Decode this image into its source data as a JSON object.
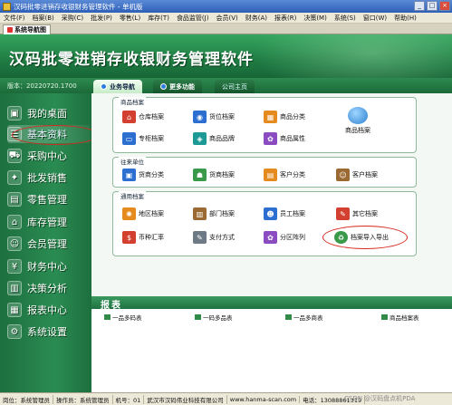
{
  "window": {
    "title": "汉码批零进销存收银财务管理软件 - 单机版",
    "buttons": [
      "_",
      "□",
      "×"
    ]
  },
  "menubar": [
    "文件(F)",
    "档案(B)",
    "采购(C)",
    "批发(P)",
    "零售(L)",
    "库存(T)",
    "食品监管(J)",
    "会员(V)",
    "财务(A)",
    "报表(R)",
    "决策(M)",
    "系统(S)",
    "窗口(W)",
    "帮助(H)"
  ],
  "doc_tab": "系统导航图",
  "banner_title": "汉码批零进销存收银财务管理软件",
  "version": "版本：20220720.1700",
  "top_tabs": [
    "业务导航",
    "更多功能",
    "公司主页"
  ],
  "sidebar": [
    {
      "label": "我的桌面",
      "icon": "monitor-icon",
      "glyph": "▣"
    },
    {
      "label": "基本资料",
      "icon": "data-icon",
      "glyph": "☰"
    },
    {
      "label": "采购中心",
      "icon": "truck-icon",
      "glyph": "⛟"
    },
    {
      "label": "批发销售",
      "icon": "sales-icon",
      "glyph": "✦"
    },
    {
      "label": "零售管理",
      "icon": "retail-icon",
      "glyph": "▤"
    },
    {
      "label": "库存管理",
      "icon": "warehouse-icon",
      "glyph": "⌂"
    },
    {
      "label": "会员管理",
      "icon": "member-icon",
      "glyph": "☺"
    },
    {
      "label": "财务中心",
      "icon": "finance-icon",
      "glyph": "¥"
    },
    {
      "label": "决策分析",
      "icon": "chart-icon",
      "glyph": "▥"
    },
    {
      "label": "报表中心",
      "icon": "report-icon",
      "glyph": "▦"
    },
    {
      "label": "系统设置",
      "icon": "settings-icon",
      "glyph": "⚙"
    }
  ],
  "panels": {
    "goods": {
      "title": "商品档案",
      "items": [
        {
          "label": "仓库档案",
          "icon": "warehouse-icon",
          "color": "c-red",
          "glyph": "⌂"
        },
        {
          "label": "货位档案",
          "icon": "location-icon",
          "color": "c-blue",
          "glyph": "◉"
        },
        {
          "label": "商品分类",
          "icon": "category-icon",
          "color": "c-orange",
          "glyph": "▦"
        },
        {
          "label": "商品档案",
          "icon": "goods-globe-icon",
          "color": "",
          "glyph": ""
        },
        {
          "label": "专柜档案",
          "icon": "counter-icon",
          "color": "c-blue",
          "glyph": "▭"
        },
        {
          "label": "商品品牌",
          "icon": "brand-icon",
          "color": "c-teal",
          "glyph": "◈"
        },
        {
          "label": "商品属性",
          "icon": "attribute-icon",
          "color": "c-purple",
          "glyph": "✿"
        }
      ]
    },
    "contacts": {
      "title": "往来单位",
      "items": [
        {
          "label": "货商分类",
          "icon": "supplier-category-icon",
          "color": "c-blue",
          "glyph": "▣"
        },
        {
          "label": "货商档案",
          "icon": "supplier-icon",
          "color": "c-green",
          "glyph": "☗"
        },
        {
          "label": "客户分类",
          "icon": "customer-category-icon",
          "color": "c-orange",
          "glyph": "▤"
        },
        {
          "label": "客户档案",
          "icon": "customer-icon",
          "color": "c-brown",
          "glyph": "☺"
        }
      ]
    },
    "common": {
      "title": "通用档案",
      "items": [
        {
          "label": "地区档案",
          "icon": "region-icon",
          "color": "c-orange",
          "glyph": "✺"
        },
        {
          "label": "部门档案",
          "icon": "department-icon",
          "color": "c-brown",
          "glyph": "▥"
        },
        {
          "label": "员工档案",
          "icon": "employee-icon",
          "color": "c-blue",
          "glyph": "☻"
        },
        {
          "label": "其它档案",
          "icon": "other-icon",
          "color": "c-red",
          "glyph": "✎"
        },
        {
          "label": "币种汇率",
          "icon": "currency-icon",
          "color": "c-red",
          "glyph": "$"
        },
        {
          "label": "支付方式",
          "icon": "payment-icon",
          "color": "c-gray",
          "glyph": "✎"
        },
        {
          "label": "分区阵列",
          "icon": "zone-icon",
          "color": "c-purple",
          "glyph": "✿"
        },
        {
          "label": "档案导入导出",
          "icon": "recycle-icon",
          "color": "c-green",
          "glyph": "♻"
        }
      ]
    }
  },
  "report": {
    "title": "报表",
    "links": [
      "一品多码表",
      "一码多品表",
      "一品多商表",
      "商品档案表"
    ]
  },
  "statusbar": [
    "岗位：系统管理员",
    "操作员：系统管理员",
    "机号：01",
    "武汉市汉码伟业科技有限公司",
    "www.hanma-scan.com",
    "电话：13088861319"
  ],
  "watermark": "CSDN @汉码盘点机PDA"
}
